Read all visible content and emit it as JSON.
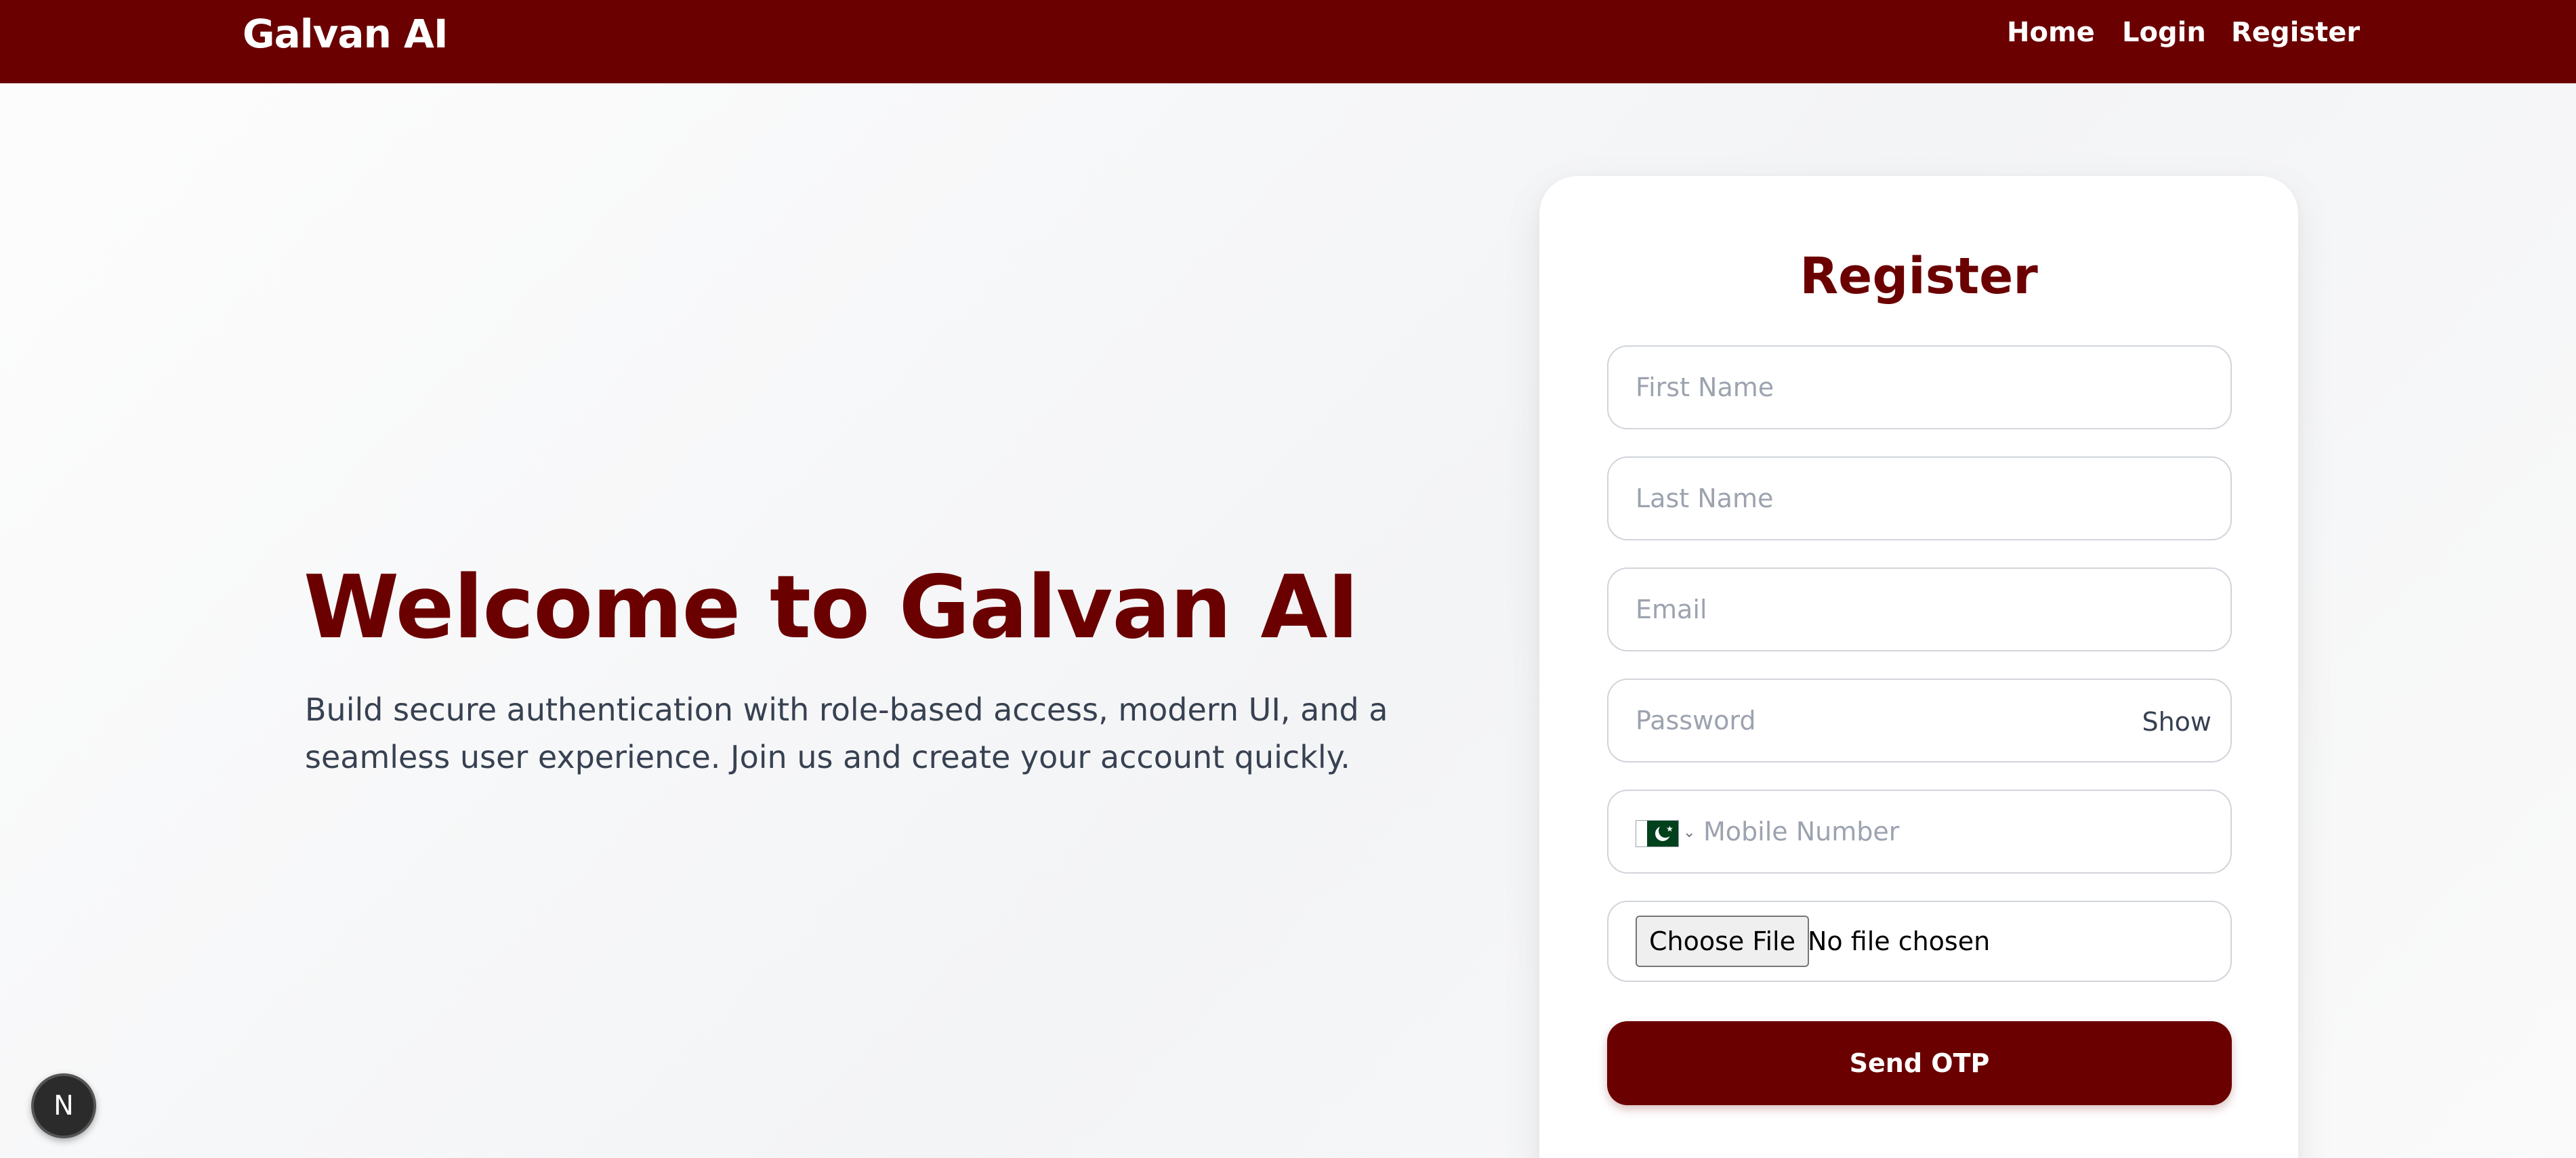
{
  "navbar": {
    "brand": "Galvan AI",
    "links": [
      "Home",
      "Login",
      "Register"
    ],
    "background_color": "#6b0000"
  },
  "hero": {
    "title": "Welcome to Galvan AI",
    "subtitle": "Build secure authentication with role-based access, modern UI, and a seamless user experience. Join us and create your account quickly."
  },
  "register_form": {
    "title": "Register",
    "first_name_placeholder": "First Name",
    "last_name_placeholder": "Last Name",
    "email_placeholder": "Email",
    "password_placeholder": "Password",
    "password_toggle_label": "Show",
    "mobile_placeholder": "Mobile Number",
    "country_flag_icon": "pakistan-flag-icon",
    "choose_file_label": "Choose File",
    "file_status": "No file chosen",
    "submit_label": "Send OTP",
    "accent_color": "#6b0000"
  },
  "dev_badge": {
    "label": "N"
  }
}
